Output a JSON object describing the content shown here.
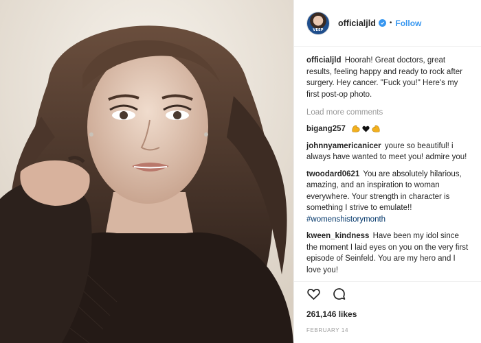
{
  "post": {
    "username": "officialjld",
    "follow_separator": "•",
    "follow_label": "Follow",
    "avatar_badge": "VEEP",
    "caption_user": "officialjld",
    "caption_text": "Hoorah! Great doctors, great results, feeling happy and ready to rock after surgery. Hey cancer. \"Fuck you!\" Here's my first post-op photo.",
    "load_more": "Load more comments",
    "comments": [
      {
        "user": "bigang257",
        "text": ""
      },
      {
        "user": "johnnyamericanicer",
        "text": "youre so beautiful! i always have wanted to meet you! admire you!"
      },
      {
        "user": "twoodard0621",
        "text": "You are absolutely hilarious, amazing, and an inspiration to woman everywhere. Your strength in character is something I strive to emulate!!",
        "hashtag": "#womenshistorymonth"
      },
      {
        "user": "kween_kindness",
        "text": "Have been my idol since the moment I laid eyes on you on the very first episode of Seinfeld. You are my hero and I love you!"
      }
    ],
    "likes": "261,146 likes",
    "date": "February 14"
  },
  "icons": {
    "verified": "verified-badge-icon",
    "like": "heart-outline-icon",
    "comment": "comment-bubble-icon",
    "emoji_1": "flexed-biceps-icon",
    "emoji_2": "black-heart-icon",
    "emoji_3": "flexed-biceps-icon"
  },
  "colors": {
    "link_blue": "#3897f0",
    "hashtag": "#003569",
    "muted": "#999999",
    "text": "#262626"
  }
}
